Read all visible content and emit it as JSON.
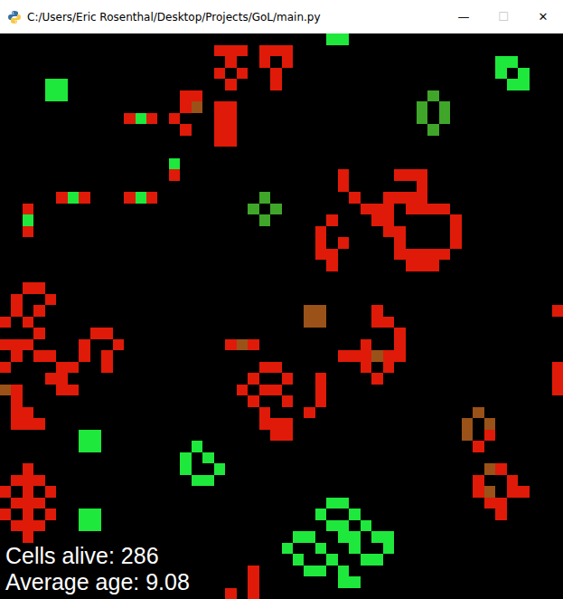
{
  "window": {
    "title": "C:/Users/Eric Rosenthal/Desktop/Projects/GoL/main.py",
    "controls": [
      {
        "glyph": "—",
        "disabled": false
      },
      {
        "glyph": "☐",
        "disabled": true
      },
      {
        "glyph": "✕",
        "disabled": false
      }
    ]
  },
  "board": {
    "palette": {
      "g": "#1ee83c",
      "h": "#3fa62a",
      "y": "#9a5218",
      "r": "#e01a08"
    },
    "cells": [
      [
        29,
        0,
        "g"
      ],
      [
        30,
        0,
        "g"
      ],
      [
        19,
        1,
        "r"
      ],
      [
        20,
        1,
        "r"
      ],
      [
        21,
        1,
        "r"
      ],
      [
        23,
        1,
        "r"
      ],
      [
        24,
        1,
        "r"
      ],
      [
        25,
        1,
        "r"
      ],
      [
        20,
        2,
        "r"
      ],
      [
        23,
        2,
        "r"
      ],
      [
        25,
        2,
        "r"
      ],
      [
        44,
        2,
        "g"
      ],
      [
        45,
        2,
        "g"
      ],
      [
        19,
        3,
        "r"
      ],
      [
        21,
        3,
        "r"
      ],
      [
        24,
        3,
        "r"
      ],
      [
        44,
        3,
        "g"
      ],
      [
        46,
        3,
        "g"
      ],
      [
        20,
        4,
        "r"
      ],
      [
        24,
        4,
        "r"
      ],
      [
        4,
        4,
        "g"
      ],
      [
        5,
        4,
        "g"
      ],
      [
        45,
        4,
        "g"
      ],
      [
        46,
        4,
        "g"
      ],
      [
        4,
        5,
        "g"
      ],
      [
        5,
        5,
        "g"
      ],
      [
        16,
        5,
        "r"
      ],
      [
        17,
        5,
        "r"
      ],
      [
        38,
        5,
        "h"
      ],
      [
        16,
        6,
        "r"
      ],
      [
        17,
        6,
        "y"
      ],
      [
        19,
        6,
        "r"
      ],
      [
        20,
        6,
        "r"
      ],
      [
        37,
        6,
        "h"
      ],
      [
        39,
        6,
        "h"
      ],
      [
        11,
        7,
        "r"
      ],
      [
        12,
        7,
        "g"
      ],
      [
        13,
        7,
        "r"
      ],
      [
        15,
        7,
        "r"
      ],
      [
        19,
        7,
        "r"
      ],
      [
        20,
        7,
        "r"
      ],
      [
        37,
        7,
        "h"
      ],
      [
        39,
        7,
        "h"
      ],
      [
        16,
        8,
        "r"
      ],
      [
        19,
        8,
        "r"
      ],
      [
        20,
        8,
        "r"
      ],
      [
        38,
        8,
        "h"
      ],
      [
        19,
        9,
        "r"
      ],
      [
        20,
        9,
        "r"
      ],
      [
        15,
        11,
        "g"
      ],
      [
        15,
        12,
        "r"
      ],
      [
        30,
        12,
        "r"
      ],
      [
        35,
        12,
        "r"
      ],
      [
        36,
        12,
        "r"
      ],
      [
        37,
        12,
        "r"
      ],
      [
        30,
        13,
        "r"
      ],
      [
        37,
        13,
        "r"
      ],
      [
        5,
        14,
        "r"
      ],
      [
        6,
        14,
        "g"
      ],
      [
        7,
        14,
        "r"
      ],
      [
        11,
        14,
        "r"
      ],
      [
        12,
        14,
        "g"
      ],
      [
        13,
        14,
        "r"
      ],
      [
        23,
        14,
        "h"
      ],
      [
        31,
        14,
        "r"
      ],
      [
        34,
        14,
        "r"
      ],
      [
        35,
        14,
        "r"
      ],
      [
        36,
        14,
        "r"
      ],
      [
        37,
        14,
        "r"
      ],
      [
        2,
        15,
        "r"
      ],
      [
        22,
        15,
        "h"
      ],
      [
        24,
        15,
        "h"
      ],
      [
        32,
        15,
        "r"
      ],
      [
        33,
        15,
        "r"
      ],
      [
        34,
        15,
        "r"
      ],
      [
        36,
        15,
        "r"
      ],
      [
        37,
        15,
        "r"
      ],
      [
        38,
        15,
        "r"
      ],
      [
        39,
        15,
        "r"
      ],
      [
        2,
        16,
        "g"
      ],
      [
        23,
        16,
        "h"
      ],
      [
        29,
        16,
        "r"
      ],
      [
        33,
        16,
        "r"
      ],
      [
        34,
        16,
        "r"
      ],
      [
        40,
        16,
        "r"
      ],
      [
        2,
        17,
        "r"
      ],
      [
        28,
        17,
        "r"
      ],
      [
        34,
        17,
        "r"
      ],
      [
        35,
        17,
        "r"
      ],
      [
        40,
        17,
        "r"
      ],
      [
        28,
        18,
        "r"
      ],
      [
        30,
        18,
        "r"
      ],
      [
        35,
        18,
        "r"
      ],
      [
        40,
        18,
        "r"
      ],
      [
        28,
        19,
        "r"
      ],
      [
        29,
        19,
        "r"
      ],
      [
        35,
        19,
        "r"
      ],
      [
        36,
        19,
        "r"
      ],
      [
        37,
        19,
        "r"
      ],
      [
        38,
        19,
        "r"
      ],
      [
        39,
        19,
        "r"
      ],
      [
        29,
        20,
        "r"
      ],
      [
        36,
        20,
        "r"
      ],
      [
        37,
        20,
        "r"
      ],
      [
        38,
        20,
        "r"
      ],
      [
        2,
        22,
        "r"
      ],
      [
        3,
        22,
        "r"
      ],
      [
        1,
        23,
        "r"
      ],
      [
        4,
        23,
        "r"
      ],
      [
        1,
        24,
        "r"
      ],
      [
        3,
        24,
        "r"
      ],
      [
        27,
        24,
        "y"
      ],
      [
        28,
        24,
        "y"
      ],
      [
        33,
        24,
        "r"
      ],
      [
        49,
        24,
        "r"
      ],
      [
        0,
        25,
        "r"
      ],
      [
        2,
        25,
        "r"
      ],
      [
        27,
        25,
        "y"
      ],
      [
        28,
        25,
        "y"
      ],
      [
        33,
        25,
        "r"
      ],
      [
        34,
        25,
        "r"
      ],
      [
        3,
        26,
        "r"
      ],
      [
        8,
        26,
        "r"
      ],
      [
        9,
        26,
        "r"
      ],
      [
        35,
        26,
        "r"
      ],
      [
        0,
        27,
        "r"
      ],
      [
        1,
        27,
        "r"
      ],
      [
        2,
        27,
        "r"
      ],
      [
        7,
        27,
        "r"
      ],
      [
        10,
        27,
        "r"
      ],
      [
        20,
        27,
        "r"
      ],
      [
        21,
        27,
        "y"
      ],
      [
        22,
        27,
        "r"
      ],
      [
        32,
        27,
        "r"
      ],
      [
        35,
        27,
        "r"
      ],
      [
        1,
        28,
        "r"
      ],
      [
        3,
        28,
        "r"
      ],
      [
        4,
        28,
        "r"
      ],
      [
        7,
        28,
        "r"
      ],
      [
        9,
        28,
        "r"
      ],
      [
        30,
        28,
        "r"
      ],
      [
        31,
        28,
        "r"
      ],
      [
        32,
        28,
        "r"
      ],
      [
        33,
        28,
        "y"
      ],
      [
        34,
        28,
        "r"
      ],
      [
        35,
        28,
        "r"
      ],
      [
        0,
        29,
        "r"
      ],
      [
        5,
        29,
        "r"
      ],
      [
        6,
        29,
        "r"
      ],
      [
        9,
        29,
        "r"
      ],
      [
        23,
        29,
        "r"
      ],
      [
        24,
        29,
        "r"
      ],
      [
        32,
        29,
        "r"
      ],
      [
        34,
        29,
        "r"
      ],
      [
        49,
        29,
        "r"
      ],
      [
        4,
        30,
        "r"
      ],
      [
        5,
        30,
        "r"
      ],
      [
        22,
        30,
        "r"
      ],
      [
        25,
        30,
        "r"
      ],
      [
        28,
        30,
        "r"
      ],
      [
        33,
        30,
        "r"
      ],
      [
        49,
        30,
        "r"
      ],
      [
        0,
        31,
        "y"
      ],
      [
        1,
        31,
        "r"
      ],
      [
        5,
        31,
        "r"
      ],
      [
        6,
        31,
        "r"
      ],
      [
        21,
        31,
        "r"
      ],
      [
        23,
        31,
        "r"
      ],
      [
        24,
        31,
        "r"
      ],
      [
        28,
        31,
        "r"
      ],
      [
        49,
        31,
        "r"
      ],
      [
        1,
        32,
        "r"
      ],
      [
        22,
        32,
        "r"
      ],
      [
        25,
        32,
        "r"
      ],
      [
        28,
        32,
        "r"
      ],
      [
        1,
        33,
        "r"
      ],
      [
        2,
        33,
        "r"
      ],
      [
        23,
        33,
        "r"
      ],
      [
        27,
        33,
        "r"
      ],
      [
        42,
        33,
        "y"
      ],
      [
        1,
        34,
        "r"
      ],
      [
        2,
        34,
        "r"
      ],
      [
        3,
        34,
        "r"
      ],
      [
        23,
        34,
        "r"
      ],
      [
        24,
        34,
        "r"
      ],
      [
        25,
        34,
        "r"
      ],
      [
        41,
        34,
        "y"
      ],
      [
        43,
        34,
        "y"
      ],
      [
        7,
        35,
        "g"
      ],
      [
        8,
        35,
        "g"
      ],
      [
        24,
        35,
        "r"
      ],
      [
        25,
        35,
        "r"
      ],
      [
        41,
        35,
        "y"
      ],
      [
        43,
        35,
        "r"
      ],
      [
        7,
        36,
        "g"
      ],
      [
        8,
        36,
        "g"
      ],
      [
        17,
        36,
        "g"
      ],
      [
        42,
        36,
        "r"
      ],
      [
        16,
        37,
        "g"
      ],
      [
        18,
        37,
        "g"
      ],
      [
        2,
        38,
        "r"
      ],
      [
        16,
        38,
        "g"
      ],
      [
        19,
        38,
        "g"
      ],
      [
        43,
        38,
        "y"
      ],
      [
        44,
        38,
        "r"
      ],
      [
        1,
        39,
        "r"
      ],
      [
        2,
        39,
        "r"
      ],
      [
        3,
        39,
        "r"
      ],
      [
        17,
        39,
        "g"
      ],
      [
        18,
        39,
        "g"
      ],
      [
        42,
        39,
        "r"
      ],
      [
        45,
        39,
        "r"
      ],
      [
        0,
        40,
        "r"
      ],
      [
        2,
        40,
        "r"
      ],
      [
        4,
        40,
        "r"
      ],
      [
        42,
        40,
        "r"
      ],
      [
        43,
        40,
        "y"
      ],
      [
        45,
        40,
        "r"
      ],
      [
        46,
        40,
        "r"
      ],
      [
        1,
        41,
        "r"
      ],
      [
        2,
        41,
        "r"
      ],
      [
        3,
        41,
        "r"
      ],
      [
        29,
        41,
        "g"
      ],
      [
        30,
        41,
        "g"
      ],
      [
        43,
        41,
        "r"
      ],
      [
        44,
        41,
        "r"
      ],
      [
        0,
        42,
        "r"
      ],
      [
        2,
        42,
        "r"
      ],
      [
        4,
        42,
        "r"
      ],
      [
        7,
        42,
        "g"
      ],
      [
        8,
        42,
        "g"
      ],
      [
        28,
        42,
        "g"
      ],
      [
        31,
        42,
        "g"
      ],
      [
        44,
        42,
        "r"
      ],
      [
        1,
        43,
        "r"
      ],
      [
        2,
        43,
        "r"
      ],
      [
        3,
        43,
        "r"
      ],
      [
        7,
        43,
        "g"
      ],
      [
        8,
        43,
        "g"
      ],
      [
        29,
        43,
        "g"
      ],
      [
        30,
        43,
        "g"
      ],
      [
        32,
        43,
        "g"
      ],
      [
        2,
        44,
        "r"
      ],
      [
        26,
        44,
        "g"
      ],
      [
        27,
        44,
        "g"
      ],
      [
        30,
        44,
        "g"
      ],
      [
        31,
        44,
        "g"
      ],
      [
        33,
        44,
        "g"
      ],
      [
        34,
        44,
        "g"
      ],
      [
        25,
        45,
        "g"
      ],
      [
        28,
        45,
        "g"
      ],
      [
        31,
        45,
        "g"
      ],
      [
        34,
        45,
        "g"
      ],
      [
        26,
        46,
        "g"
      ],
      [
        29,
        46,
        "g"
      ],
      [
        32,
        46,
        "g"
      ],
      [
        33,
        46,
        "g"
      ],
      [
        22,
        47,
        "r"
      ],
      [
        27,
        47,
        "g"
      ],
      [
        28,
        47,
        "g"
      ],
      [
        30,
        47,
        "g"
      ],
      [
        22,
        48,
        "r"
      ],
      [
        30,
        48,
        "g"
      ],
      [
        31,
        48,
        "g"
      ],
      [
        20,
        49,
        "r"
      ],
      [
        22,
        49,
        "r"
      ]
    ]
  },
  "stats": [
    "Cells alive: 286",
    "Average age: 9.08"
  ]
}
